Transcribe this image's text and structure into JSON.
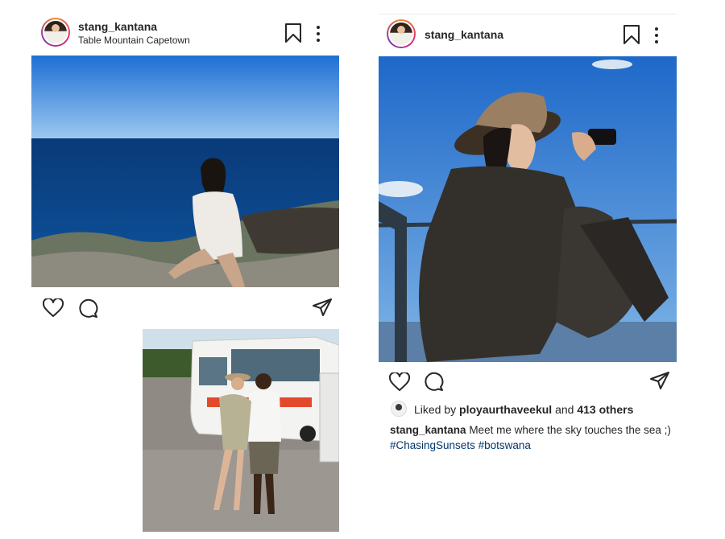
{
  "post1": {
    "username": "stang_kantana",
    "location": "Table Mountain Capetown"
  },
  "post2": {
    "username": "stang_kantana",
    "liked_by_prefix": "Liked by",
    "liked_by_user": "ployaurthaveekul",
    "liked_by_and": "and",
    "liked_by_others": "413 others",
    "caption_user": "stang_kantana",
    "caption_text": "Meet me where the sky touches the sea ;)",
    "hashtags": [
      "#ChasingSunsets",
      "#botswana"
    ]
  },
  "icons": [
    "bookmark-icon",
    "more-options-icon",
    "heart-icon",
    "comment-icon",
    "share-icon"
  ]
}
